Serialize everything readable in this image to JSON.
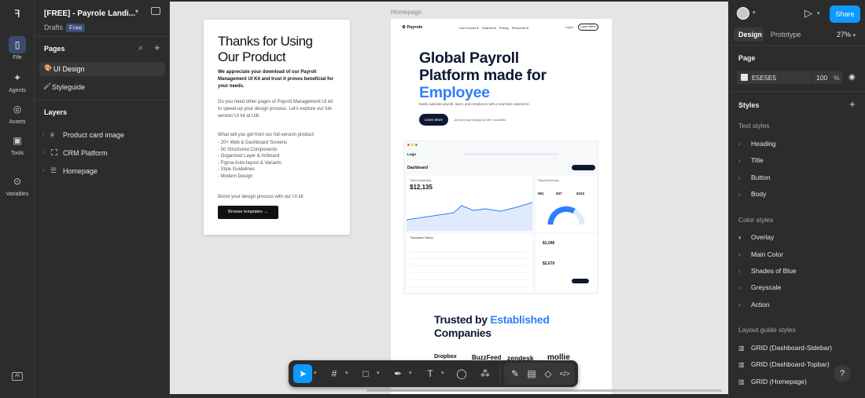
{
  "app": {
    "file_title": "[FREE] - Payrole Landi...",
    "drafts": "Drafts",
    "plan_badge": "Free"
  },
  "rail": {
    "file": "File",
    "agents": "Agents",
    "assets": "Assets",
    "tools": "Tools",
    "variables": "Variables",
    "ai_label": "AI"
  },
  "pages": {
    "title": "Pages",
    "items": [
      "UI Design",
      "Styleguide"
    ]
  },
  "layers": {
    "title": "Layers",
    "items": [
      "Product card image",
      "CRM Platform",
      "Homepage"
    ]
  },
  "canvas": {
    "frame_label": "Homepage",
    "thanks": {
      "title": "Thanks for Using Our Product",
      "lead": "We appreciate your download of our Payroll Management UI Kit and trust it proves beneficial for your needs.",
      "para": "Do you need other pages of Payroll Management UI kit to speed-up your design process. Let's explore our full-version UI kit at Ui8.",
      "list_head": "What will you get from our full-version product:",
      "list": [
        "- 20+ Web & Dashboard Screens",
        "- 50 Structured Components",
        "- Organized Layer & Artboard",
        "- Figma Auto-layout & Variants",
        "- Style Guidelines",
        "- Modern Design"
      ],
      "boost": "Boost your design process with our UI kit",
      "button": "Browse templates →"
    },
    "landing": {
      "brand": "Payrole",
      "nav": [
        "How it works",
        "Features",
        "Pricing",
        "Resources"
      ],
      "login": "Log in",
      "learn_btn": "Learn More",
      "hero_line1": "Global Payroll",
      "hero_line2": "Platform made for",
      "hero_accent": "Employee",
      "hero_sub": "Easily automate payroll, taxes, and compliance with a seamless experience.",
      "cta": "Learn More",
      "cta_note": "Join and pay comply by 100+ countries",
      "dash": {
        "logo": "Logo",
        "title": "Dashboard",
        "total_label": "Total Outstanding",
        "total_value": "$12,135",
        "payroll_label": "Payroll Summary",
        "tx_label": "Transaction History",
        "amounts": [
          "$91",
          "$37",
          "$234"
        ],
        "value1": "$1,546",
        "value2": "$2,670"
      },
      "trusted_pre": "Trusted by ",
      "trusted_accent": "Established",
      "trusted_post": "Companies",
      "brands": [
        "Dropbox",
        "BuzzFeed",
        "zendesk",
        "mollie"
      ]
    }
  },
  "right": {
    "share": "Share",
    "tabs": [
      "Design",
      "Prototype"
    ],
    "zoom": "27%",
    "page_title": "Page",
    "page_color": "E5E5E5",
    "page_opacity": "100",
    "percent": "%",
    "styles_title": "Styles",
    "text_styles_title": "Text styles",
    "text_styles": [
      "Heading",
      "Title",
      "Button",
      "Body"
    ],
    "color_styles_title": "Color styles",
    "color_styles": [
      "Overlay",
      "Main Color",
      "Shades of Blue",
      "Greyscale",
      "Action"
    ],
    "layout_title": "Layout guide styles",
    "layout_styles": [
      "GRID (Dashboard-Sidebar)",
      "GRID (Dashboard-Topbar)",
      "GRID (Homepage)"
    ],
    "help": "?"
  },
  "colors": {
    "accent": "#0d99ff",
    "brand_blue": "#2d7ff9",
    "navy": "#0f1733",
    "canvas_bg": "#e5e5e5"
  }
}
